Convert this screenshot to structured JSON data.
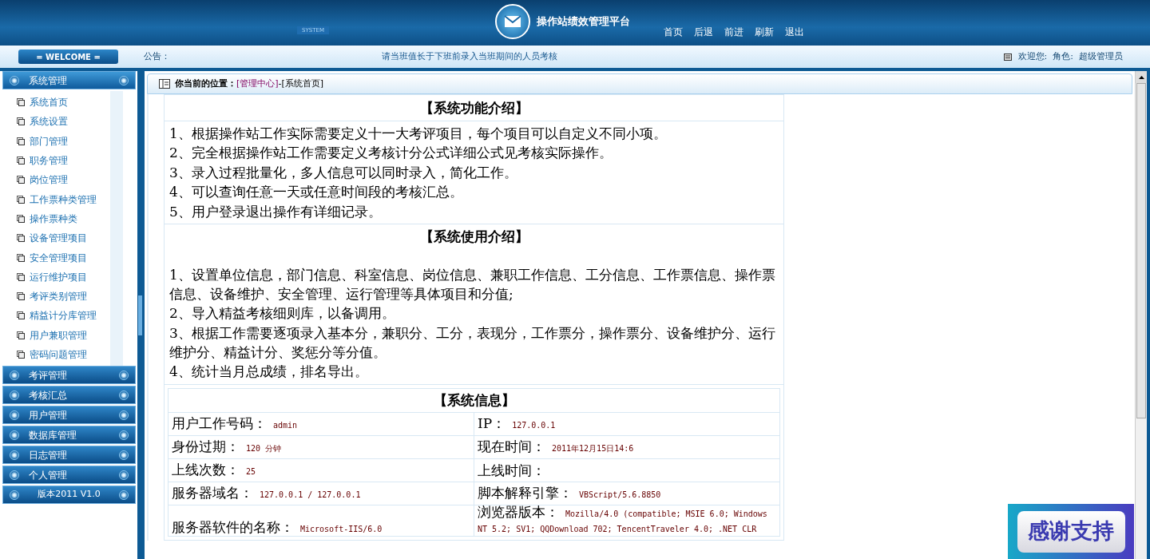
{
  "header": {
    "system_tag": "SYSTEM",
    "title": "操作站绩效管理平台",
    "nav": [
      "首页",
      "后退",
      "前进",
      "刷新",
      "退出"
    ]
  },
  "notice_bar": {
    "welcome": "= WELCOME =",
    "label": "公告：",
    "message": "请当班值长于下班前录入当班期间的人员考核",
    "user": "欢迎您:  角色:  超级管理员"
  },
  "sidebar": {
    "groups": [
      {
        "title": "系统管理",
        "expanded": true,
        "items": [
          "系统首页",
          "系统设置",
          "部门管理",
          "职务管理",
          "岗位管理",
          "工作票种类管理",
          "操作票种类",
          "设备管理项目",
          "安全管理项目",
          "运行维护项目",
          "考评类别管理",
          "精益计分库管理",
          "用户兼职管理",
          "密码问题管理"
        ]
      },
      {
        "title": "考评管理",
        "expanded": false
      },
      {
        "title": "考核汇总",
        "expanded": false
      },
      {
        "title": "用户管理",
        "expanded": false
      },
      {
        "title": "数据库管理",
        "expanded": false
      },
      {
        "title": "日志管理",
        "expanded": false
      },
      {
        "title": "个人管理",
        "expanded": false
      }
    ],
    "version": "版本2011 V1.0"
  },
  "breadcrumb": {
    "label": "你当前的位置：",
    "link": "[管理中心]",
    "current": "-[系统首页]"
  },
  "features": {
    "title": "【系统功能介绍】",
    "lines": [
      "1、根据操作站工作实际需要定义十一大考评项目，每个项目可以自定义不同小项。",
      "2、完全根据操作站工作需要定义考核计分公式详细公式见考核实际操作。",
      "3、录入过程批量化，多人信息可以同时录入，简化工作。",
      "4、可以查询任意一天或任意时间段的考核汇总。",
      "5、用户登录退出操作有详细记录。"
    ]
  },
  "usage": {
    "title": "【系统使用介绍】",
    "lines": [
      "1、设置单位信息，部门信息、科室信息、岗位信息、兼职工作信息、工分信息、工作票信息、操作票信息、设备维护、安全管理、运行管理等具体项目和分值;",
      "2、导入精益考核细则库，以备调用。",
      "3、根据工作需要逐项录入基本分，兼职分、工分，表现分，工作票分，操作票分、设备维护分、运行维护分、精益计分、奖惩分等分值。",
      "4、统计当月总成绩，排名导出。"
    ]
  },
  "system_info": {
    "title": "【系统信息】",
    "rows": [
      [
        {
          "label": "用户工作号码：",
          "value": "admin"
        },
        {
          "label": "IP：",
          "value": "127.0.0.1"
        }
      ],
      [
        {
          "label": "身份过期：",
          "value": "120 分钟"
        },
        {
          "label": "现在时间：",
          "value": "2011年12月15日14:6"
        }
      ],
      [
        {
          "label": "上线次数：",
          "value": "25"
        },
        {
          "label": "上线时间："
        }
      ],
      [
        {
          "label": "服务器域名：",
          "value": "127.0.0.1 / 127.0.0.1"
        },
        {
          "label": "脚本解释引擎：",
          "value": "VBScript/5.6.8850"
        }
      ],
      [
        {
          "label": "服务器软件的名称：",
          "value": "Microsoft-IIS/6.0"
        },
        {
          "label": "浏览器版本：",
          "value": "Mozilla/4.0 (compatible; MSIE 6.0; Windows NT 5.2; SV1; QQDownload 702; TencentTraveler 4.0; .NET CLR"
        }
      ]
    ]
  },
  "badge": "感谢支持"
}
